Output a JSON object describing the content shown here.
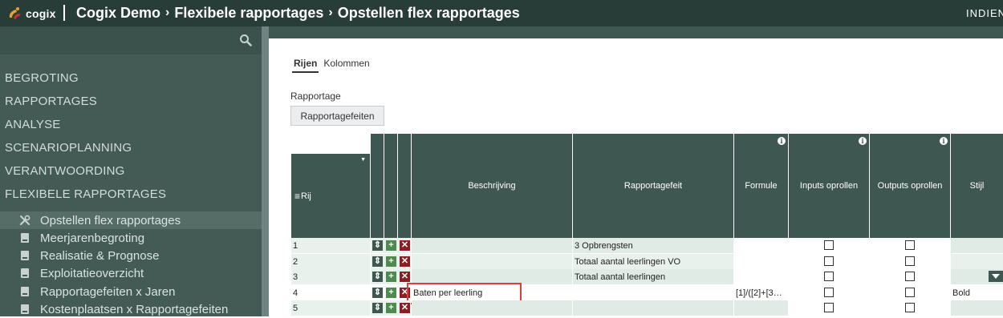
{
  "topbar": {
    "logo_text": "cogix",
    "breadcrumb": [
      "Cogix Demo",
      "Flexibele rapportages",
      "Opstellen flex rapportages"
    ],
    "right_text": "INDIENEN",
    "colors": {
      "bar": "#283d37",
      "logo_orange": "#e7a22d",
      "logo_red": "#c9352b"
    }
  },
  "sidebar": {
    "search_icon": "search-icon",
    "menu": [
      "BEGROTING",
      "RAPPORTAGES",
      "ANALYSE",
      "SCENARIOPLANNING",
      "VERANTWOORDING",
      "FLEXIBELE RAPPORTAGES"
    ],
    "submenu": [
      {
        "label": "Opstellen flex rapportages",
        "icon": "wrench-icon",
        "active": true
      },
      {
        "label": "Meerjarenbegroting",
        "icon": "document-icon",
        "active": false
      },
      {
        "label": "Realisatie & Prognose",
        "icon": "document-icon",
        "active": false
      },
      {
        "label": "Exploitatieoverzicht",
        "icon": "document-icon",
        "active": false
      },
      {
        "label": "Rapportagefeiten x Jaren",
        "icon": "document-icon",
        "active": false
      },
      {
        "label": "Kostenplaatsen x Rapportagefeiten",
        "icon": "document-icon",
        "active": false
      }
    ]
  },
  "main": {
    "tabs": [
      {
        "label": "Rijen",
        "active": true
      },
      {
        "label": "Kolommen",
        "active": false
      }
    ],
    "rapportage_label": "Rapportage",
    "rapportage_button": "Rapportagefeiten"
  },
  "grid": {
    "columns": {
      "rij": "Rij",
      "beschrijving": "Beschrijving",
      "rapportagefeit": "Rapportagefeit",
      "formule": "Formule",
      "inputs_oprollen": "Inputs oprollen",
      "outputs_oprollen": "Outputs oprollen",
      "stijl": "Stijl"
    },
    "info_icon_glyph": "i",
    "rows": [
      {
        "rij": "1",
        "beschrijving": "",
        "rapportagefeit": "3 Opbrengsten",
        "formule": "",
        "stijl": ""
      },
      {
        "rij": "2",
        "beschrijving": "",
        "rapportagefeit": "Totaal aantal leerlingen VO",
        "formule": "",
        "stijl": ""
      },
      {
        "rij": "3",
        "beschrijving": "",
        "rapportagefeit": "Totaal aantal leerlingen",
        "formule": "",
        "stijl": ""
      },
      {
        "rij": "4",
        "beschrijving": "Baten per leerling",
        "rapportagefeit": "",
        "formule": "[1]/([2]+[3…",
        "stijl": "Bold"
      },
      {
        "rij": "5",
        "beschrijving": "",
        "rapportagefeit": "",
        "formule": "",
        "stijl": ""
      }
    ],
    "selected_row": "4",
    "colors": {
      "header": "#3f5751",
      "row_green": "#dfebe4",
      "highlight": "#e53a3a",
      "add": "#4e8b4e",
      "delete": "#8a1e22"
    }
  }
}
